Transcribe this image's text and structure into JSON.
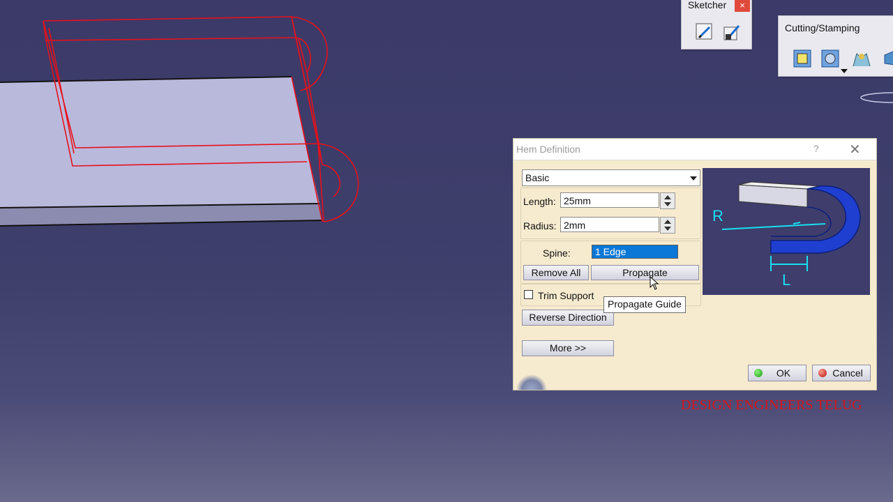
{
  "sketcher_toolbar": {
    "title": "Sketcher",
    "close": "×",
    "icons": [
      "sketch-icon",
      "positioned-sketch-icon"
    ]
  },
  "cutting_toolbar": {
    "title": "Cutting/Stamping",
    "icons": [
      "cut-out-icon",
      "hole-icon",
      "stamp-icon",
      "more-stamp-icon"
    ]
  },
  "dialog": {
    "title": "Hem Definition",
    "help": "?",
    "close": "✕",
    "type_select": "Basic",
    "length_label": "Length:",
    "length_value": "25mm",
    "radius_label": "Radius:",
    "radius_value": "2mm",
    "spine_label": "Spine:",
    "spine_value": "1 Edge",
    "remove_all": "Remove All",
    "propagate": "Propagate",
    "trim_support": "Trim Support",
    "reverse_direction": "Reverse Direction",
    "more": "More >>",
    "ok": "OK",
    "cancel": "Cancel",
    "preview_labels": {
      "radius": "R",
      "length": "L"
    }
  },
  "tooltip": "Propagate Guide",
  "watermark": "DESIGN ENGINEERS TELUG",
  "colors": {
    "background": "#3b3a68",
    "wireframe": "#e8101a",
    "dialog_bg": "#f7ebcf",
    "spine_highlight": "#0a78d7",
    "preview_bg": "#3e3d6c",
    "watermark": "#d9141a"
  },
  "checkbox_trim_support": false
}
